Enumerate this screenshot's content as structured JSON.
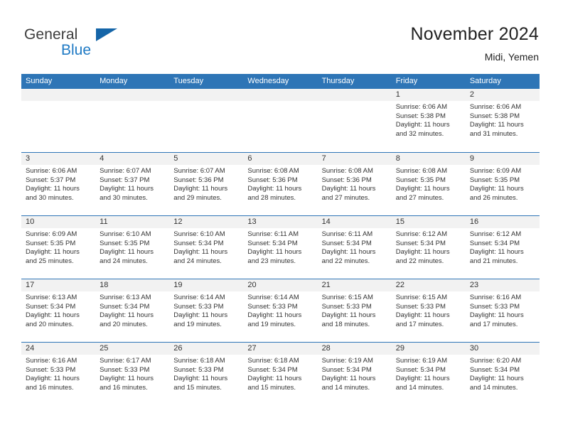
{
  "brand": {
    "name_part1": "General",
    "name_part2": "Blue",
    "accent_color": "#1f7ac4",
    "triangle_color": "#1565a8"
  },
  "header": {
    "title": "November 2024",
    "location": "Midi, Yemen"
  },
  "theme": {
    "header_row_bg": "#2e75b6",
    "day_band_bg": "#f2f2f2",
    "separator_color": "#2e75b6",
    "text_color": "#333333"
  },
  "weekdays": [
    "Sunday",
    "Monday",
    "Tuesday",
    "Wednesday",
    "Thursday",
    "Friday",
    "Saturday"
  ],
  "weeks": [
    [
      {
        "empty": true
      },
      {
        "empty": true
      },
      {
        "empty": true
      },
      {
        "empty": true
      },
      {
        "empty": true
      },
      {
        "day": "1",
        "sunrise": "Sunrise: 6:06 AM",
        "sunset": "Sunset: 5:38 PM",
        "daylight": "Daylight: 11 hours and 32 minutes."
      },
      {
        "day": "2",
        "sunrise": "Sunrise: 6:06 AM",
        "sunset": "Sunset: 5:38 PM",
        "daylight": "Daylight: 11 hours and 31 minutes."
      }
    ],
    [
      {
        "day": "3",
        "sunrise": "Sunrise: 6:06 AM",
        "sunset": "Sunset: 5:37 PM",
        "daylight": "Daylight: 11 hours and 30 minutes."
      },
      {
        "day": "4",
        "sunrise": "Sunrise: 6:07 AM",
        "sunset": "Sunset: 5:37 PM",
        "daylight": "Daylight: 11 hours and 30 minutes."
      },
      {
        "day": "5",
        "sunrise": "Sunrise: 6:07 AM",
        "sunset": "Sunset: 5:36 PM",
        "daylight": "Daylight: 11 hours and 29 minutes."
      },
      {
        "day": "6",
        "sunrise": "Sunrise: 6:08 AM",
        "sunset": "Sunset: 5:36 PM",
        "daylight": "Daylight: 11 hours and 28 minutes."
      },
      {
        "day": "7",
        "sunrise": "Sunrise: 6:08 AM",
        "sunset": "Sunset: 5:36 PM",
        "daylight": "Daylight: 11 hours and 27 minutes."
      },
      {
        "day": "8",
        "sunrise": "Sunrise: 6:08 AM",
        "sunset": "Sunset: 5:35 PM",
        "daylight": "Daylight: 11 hours and 27 minutes."
      },
      {
        "day": "9",
        "sunrise": "Sunrise: 6:09 AM",
        "sunset": "Sunset: 5:35 PM",
        "daylight": "Daylight: 11 hours and 26 minutes."
      }
    ],
    [
      {
        "day": "10",
        "sunrise": "Sunrise: 6:09 AM",
        "sunset": "Sunset: 5:35 PM",
        "daylight": "Daylight: 11 hours and 25 minutes."
      },
      {
        "day": "11",
        "sunrise": "Sunrise: 6:10 AM",
        "sunset": "Sunset: 5:35 PM",
        "daylight": "Daylight: 11 hours and 24 minutes."
      },
      {
        "day": "12",
        "sunrise": "Sunrise: 6:10 AM",
        "sunset": "Sunset: 5:34 PM",
        "daylight": "Daylight: 11 hours and 24 minutes."
      },
      {
        "day": "13",
        "sunrise": "Sunrise: 6:11 AM",
        "sunset": "Sunset: 5:34 PM",
        "daylight": "Daylight: 11 hours and 23 minutes."
      },
      {
        "day": "14",
        "sunrise": "Sunrise: 6:11 AM",
        "sunset": "Sunset: 5:34 PM",
        "daylight": "Daylight: 11 hours and 22 minutes."
      },
      {
        "day": "15",
        "sunrise": "Sunrise: 6:12 AM",
        "sunset": "Sunset: 5:34 PM",
        "daylight": "Daylight: 11 hours and 22 minutes."
      },
      {
        "day": "16",
        "sunrise": "Sunrise: 6:12 AM",
        "sunset": "Sunset: 5:34 PM",
        "daylight": "Daylight: 11 hours and 21 minutes."
      }
    ],
    [
      {
        "day": "17",
        "sunrise": "Sunrise: 6:13 AM",
        "sunset": "Sunset: 5:34 PM",
        "daylight": "Daylight: 11 hours and 20 minutes."
      },
      {
        "day": "18",
        "sunrise": "Sunrise: 6:13 AM",
        "sunset": "Sunset: 5:34 PM",
        "daylight": "Daylight: 11 hours and 20 minutes."
      },
      {
        "day": "19",
        "sunrise": "Sunrise: 6:14 AM",
        "sunset": "Sunset: 5:33 PM",
        "daylight": "Daylight: 11 hours and 19 minutes."
      },
      {
        "day": "20",
        "sunrise": "Sunrise: 6:14 AM",
        "sunset": "Sunset: 5:33 PM",
        "daylight": "Daylight: 11 hours and 19 minutes."
      },
      {
        "day": "21",
        "sunrise": "Sunrise: 6:15 AM",
        "sunset": "Sunset: 5:33 PM",
        "daylight": "Daylight: 11 hours and 18 minutes."
      },
      {
        "day": "22",
        "sunrise": "Sunrise: 6:15 AM",
        "sunset": "Sunset: 5:33 PM",
        "daylight": "Daylight: 11 hours and 17 minutes."
      },
      {
        "day": "23",
        "sunrise": "Sunrise: 6:16 AM",
        "sunset": "Sunset: 5:33 PM",
        "daylight": "Daylight: 11 hours and 17 minutes."
      }
    ],
    [
      {
        "day": "24",
        "sunrise": "Sunrise: 6:16 AM",
        "sunset": "Sunset: 5:33 PM",
        "daylight": "Daylight: 11 hours and 16 minutes."
      },
      {
        "day": "25",
        "sunrise": "Sunrise: 6:17 AM",
        "sunset": "Sunset: 5:33 PM",
        "daylight": "Daylight: 11 hours and 16 minutes."
      },
      {
        "day": "26",
        "sunrise": "Sunrise: 6:18 AM",
        "sunset": "Sunset: 5:33 PM",
        "daylight": "Daylight: 11 hours and 15 minutes."
      },
      {
        "day": "27",
        "sunrise": "Sunrise: 6:18 AM",
        "sunset": "Sunset: 5:34 PM",
        "daylight": "Daylight: 11 hours and 15 minutes."
      },
      {
        "day": "28",
        "sunrise": "Sunrise: 6:19 AM",
        "sunset": "Sunset: 5:34 PM",
        "daylight": "Daylight: 11 hours and 14 minutes."
      },
      {
        "day": "29",
        "sunrise": "Sunrise: 6:19 AM",
        "sunset": "Sunset: 5:34 PM",
        "daylight": "Daylight: 11 hours and 14 minutes."
      },
      {
        "day": "30",
        "sunrise": "Sunrise: 6:20 AM",
        "sunset": "Sunset: 5:34 PM",
        "daylight": "Daylight: 11 hours and 14 minutes."
      }
    ]
  ]
}
